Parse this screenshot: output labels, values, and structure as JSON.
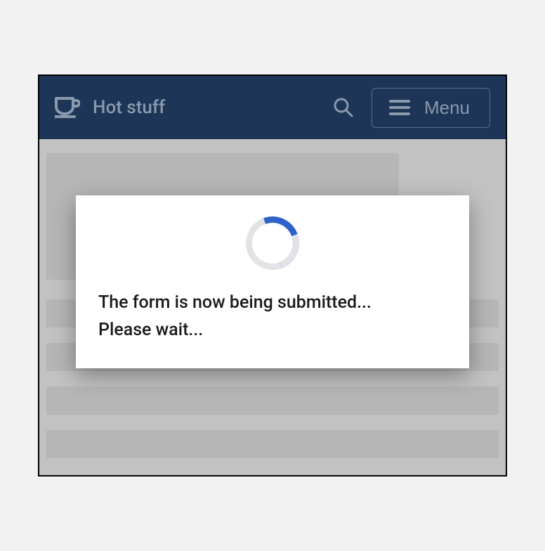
{
  "header": {
    "brand_label": "Hot stuff",
    "menu_label": "Menu"
  },
  "modal": {
    "line1": "The form is now being submitted...",
    "line2": "Please wait..."
  }
}
